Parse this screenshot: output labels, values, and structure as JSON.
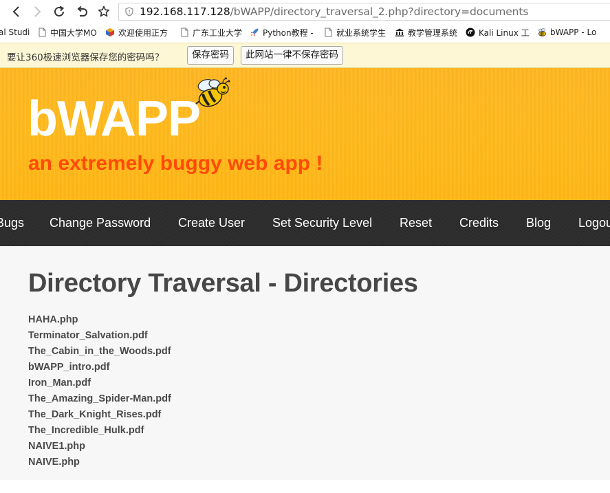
{
  "browser": {
    "url_host": "192.168.117.128",
    "url_path": "/bWAPP/directory_traversal_2.php?directory=documents"
  },
  "bookmarks": [
    {
      "label": "al Studi",
      "icon": "none"
    },
    {
      "label": "中国大学MO",
      "icon": "page-icon"
    },
    {
      "label": "欢迎使用正方",
      "icon": "cube-icon"
    },
    {
      "label": "广东工业大学",
      "icon": "page-icon"
    },
    {
      "label": "Python教程 -",
      "icon": "rocket-icon"
    },
    {
      "label": "就业系统学生",
      "icon": "page-icon"
    },
    {
      "label": "教学管理系统",
      "icon": "building-icon"
    },
    {
      "label": "Kali Linux 工",
      "icon": "kali-icon"
    },
    {
      "label": "bWAPP - Lo",
      "icon": "bee-icon"
    }
  ],
  "password_bar": {
    "message": "要让360极速浏览器保存您的密码吗？",
    "save_label": "保存密码",
    "never_label": "此网站一律不保存密码"
  },
  "header": {
    "logo": "bWAPP",
    "tagline": "an extremely buggy web app !"
  },
  "menu": [
    "Bugs",
    "Change Password",
    "Create User",
    "Set Security Level",
    "Reset",
    "Credits",
    "Blog",
    "Logout"
  ],
  "main": {
    "title": "Directory Traversal - Directories",
    "files": [
      "HAHA.php",
      "Terminator_Salvation.pdf",
      "The_Cabin_in_the_Woods.pdf",
      "bWAPP_intro.pdf",
      "Iron_Man.pdf",
      "The_Amazing_Spider-Man.pdf",
      "The_Dark_Knight_Rises.pdf",
      "The_Incredible_Hulk.pdf",
      "NAIVE1.php",
      "NAIVE.php"
    ]
  },
  "colors": {
    "header_bg": "#ffb81c",
    "tagline": "#ff4b07",
    "menubar_bg": "#2b2b2b",
    "content_bg": "#f7f7f7",
    "title_text": "#474747"
  }
}
